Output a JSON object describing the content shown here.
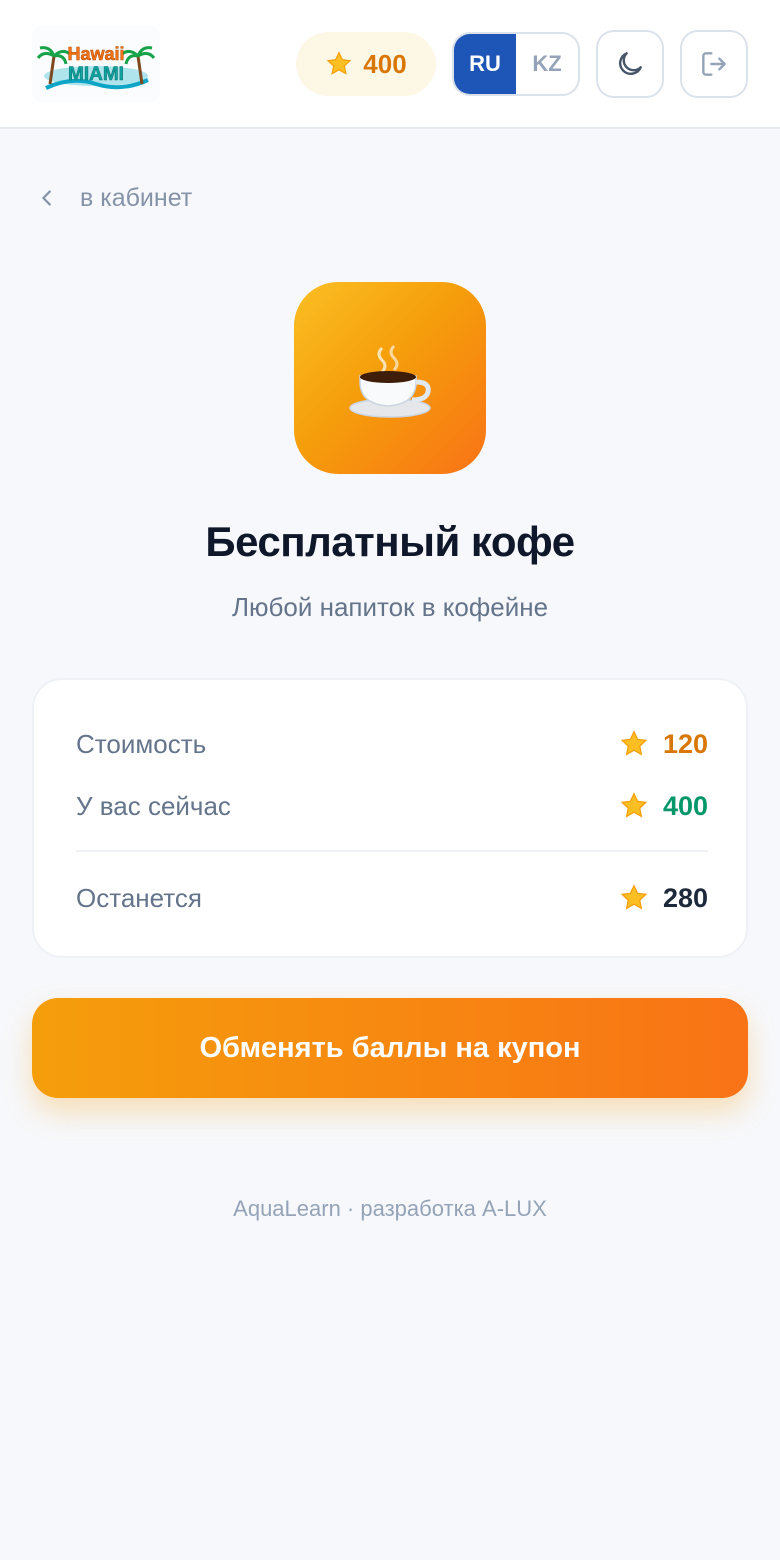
{
  "header": {
    "logo_text_top": "Hawaii",
    "logo_text_bottom": "MIAMI",
    "points": "400",
    "languages": [
      "RU",
      "KZ"
    ],
    "active_language": "RU"
  },
  "back_link": {
    "label": "в кабинет"
  },
  "reward": {
    "icon": "coffee-cup-icon",
    "title": "Бесплатный кофе",
    "subtitle": "Любой напиток в кофейне"
  },
  "summary": {
    "cost_label": "Стоимость",
    "cost_value": "120",
    "current_label": "У вас сейчас",
    "current_value": "400",
    "remaining_label": "Останется",
    "remaining_value": "280"
  },
  "cta": {
    "label": "Обменять баллы на купон"
  },
  "footer": {
    "text": "AquaLearn · разработка A-LUX"
  },
  "colors": {
    "accent_orange": "#f59e0b",
    "brand_blue": "#1e56b8",
    "positive_green": "#059669"
  }
}
